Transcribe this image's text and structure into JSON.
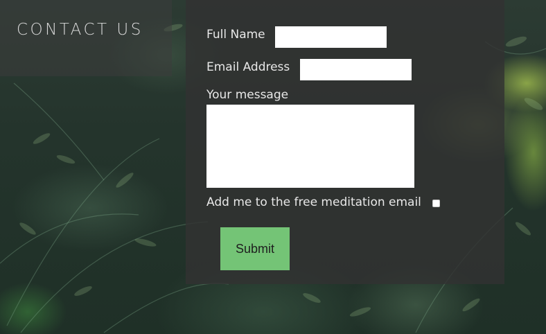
{
  "header": {
    "title": "CONTACT US"
  },
  "form": {
    "full_name_label": "Full Name",
    "full_name_value": "",
    "email_label": "Email Address",
    "email_value": "",
    "message_label": "Your message",
    "message_value": "",
    "newsletter_label": "Add me to the free meditation email",
    "newsletter_checked": false,
    "submit_label": "Submit"
  },
  "colors": {
    "submit_bg": "#74c476",
    "panel_bg": "#323232"
  }
}
